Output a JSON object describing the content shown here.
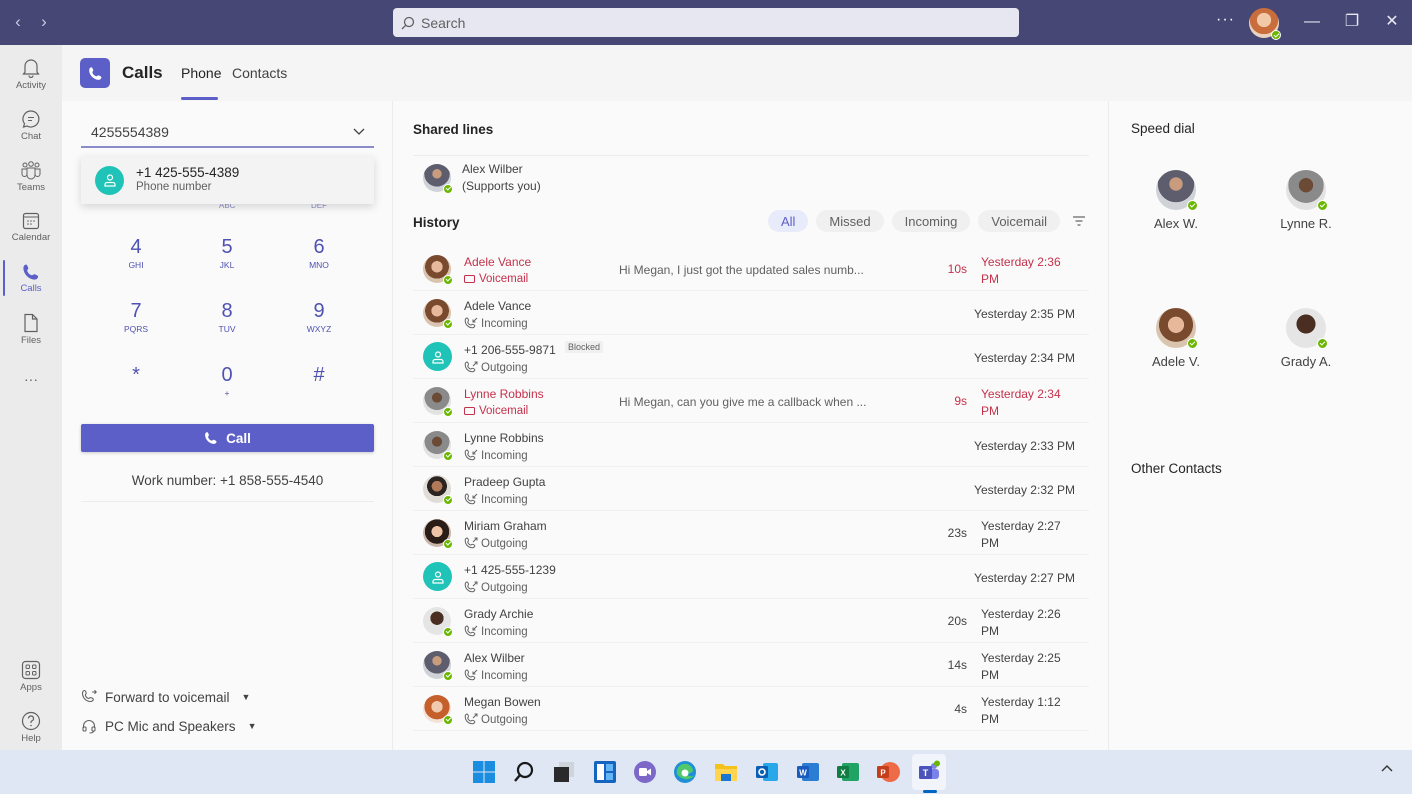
{
  "titlebar": {
    "back_label": "‹",
    "forward_label": "›",
    "search_placeholder": "Search",
    "more_label": "···",
    "minimize_label": "—",
    "maximize_label": "❐",
    "close_label": "✕"
  },
  "rail": {
    "items": [
      {
        "label": "Activity",
        "icon": "bell-icon"
      },
      {
        "label": "Chat",
        "icon": "chat-icon"
      },
      {
        "label": "Teams",
        "icon": "teams-icon"
      },
      {
        "label": "Calendar",
        "icon": "calendar-icon"
      },
      {
        "label": "Calls",
        "icon": "phone-icon",
        "active": true
      },
      {
        "label": "Files",
        "icon": "file-icon"
      }
    ],
    "more_label": "···",
    "apps_label": "Apps",
    "help_label": "Help"
  },
  "header": {
    "title": "Calls",
    "tabs": [
      {
        "label": "Phone",
        "active": true
      },
      {
        "label": "Contacts",
        "active": false
      }
    ]
  },
  "dialer": {
    "input_value": "4255554389",
    "suggestion": {
      "number": "+1 425-555-4389",
      "type": "Phone number"
    },
    "hidden_letters": [
      "ABC",
      "DEF"
    ],
    "keys": [
      {
        "digit": "4",
        "letters": "GHI"
      },
      {
        "digit": "5",
        "letters": "JKL"
      },
      {
        "digit": "6",
        "letters": "MNO"
      },
      {
        "digit": "7",
        "letters": "PQRS"
      },
      {
        "digit": "8",
        "letters": "TUV"
      },
      {
        "digit": "9",
        "letters": "WXYZ"
      },
      {
        "digit": "*",
        "letters": ""
      },
      {
        "digit": "0",
        "letters": "+"
      },
      {
        "digit": "#",
        "letters": ""
      }
    ],
    "call_label": "Call",
    "work_number": "Work number: +1 858-555-4540",
    "forward_label": "Forward to voicemail",
    "device_label": "PC Mic and Speakers"
  },
  "shared_lines": {
    "title": "Shared lines",
    "name": "Alex Wilber",
    "sub": "(Supports you)"
  },
  "history": {
    "title": "History",
    "filters": [
      {
        "label": "All",
        "active": true
      },
      {
        "label": "Missed",
        "active": false
      },
      {
        "label": "Incoming",
        "active": false
      },
      {
        "label": "Voicemail",
        "active": false
      }
    ],
    "rows": [
      {
        "name": "Adele Vance",
        "type": "Voicemail",
        "preview": "Hi Megan, I just got the updated sales numb...",
        "duration": "10s",
        "time": "Yesterday 2:36 PM",
        "missed": true,
        "avatar": "adele"
      },
      {
        "name": "Adele Vance",
        "type": "Incoming",
        "preview": "",
        "duration": "",
        "time": "Yesterday 2:35 PM",
        "missed": false,
        "avatar": "adele"
      },
      {
        "name": "+1 206-555-9871",
        "type": "Outgoing",
        "preview": "",
        "duration": "",
        "time": "Yesterday 2:34 PM",
        "missed": false,
        "avatar": "phone",
        "badge": "Blocked"
      },
      {
        "name": "Lynne Robbins",
        "type": "Voicemail",
        "preview": "Hi Megan, can you give me a callback when ...",
        "duration": "9s",
        "time": "Yesterday 2:34 PM",
        "missed": true,
        "avatar": "lynne"
      },
      {
        "name": "Lynne Robbins",
        "type": "Incoming",
        "preview": "",
        "duration": "",
        "time": "Yesterday 2:33 PM",
        "missed": false,
        "avatar": "lynne"
      },
      {
        "name": "Pradeep Gupta",
        "type": "Incoming",
        "preview": "",
        "duration": "",
        "time": "Yesterday 2:32 PM",
        "missed": false,
        "avatar": "pradeep"
      },
      {
        "name": "Miriam Graham",
        "type": "Outgoing",
        "preview": "",
        "duration": "23s",
        "time": "Yesterday 2:27 PM",
        "missed": false,
        "avatar": "miriam"
      },
      {
        "name": "+1 425-555-1239",
        "type": "Outgoing",
        "preview": "",
        "duration": "",
        "time": "Yesterday 2:27 PM",
        "missed": false,
        "avatar": "phone"
      },
      {
        "name": "Grady Archie",
        "type": "Incoming",
        "preview": "",
        "duration": "20s",
        "time": "Yesterday 2:26 PM",
        "missed": false,
        "avatar": "grady"
      },
      {
        "name": "Alex Wilber",
        "type": "Incoming",
        "preview": "",
        "duration": "14s",
        "time": "Yesterday 2:25 PM",
        "missed": false,
        "avatar": "alex"
      },
      {
        "name": "Megan Bowen",
        "type": "Outgoing",
        "preview": "",
        "duration": "4s",
        "time": "Yesterday 1:12 PM",
        "missed": false,
        "avatar": "megan"
      }
    ]
  },
  "speed_dial": {
    "title": "Speed dial",
    "contacts": [
      {
        "name": "Alex W.",
        "avatar": "alex"
      },
      {
        "name": "Lynne R.",
        "avatar": "lynne"
      },
      {
        "name": "Adele V.",
        "avatar": "adele"
      },
      {
        "name": "Grady A.",
        "avatar": "grady"
      }
    ],
    "other_title": "Other Contacts"
  },
  "taskbar": {
    "apps": [
      "start",
      "search",
      "task-view",
      "widgets",
      "teams-chat",
      "edge",
      "file-explorer",
      "outlook",
      "word",
      "excel",
      "powerpoint",
      "teams"
    ]
  },
  "colors": {
    "brand": "#5b5fc7",
    "titlebar": "#464775",
    "missed": "#c4314b",
    "presence": "#6bb700",
    "teal_avatar": "#1fc3b8"
  }
}
